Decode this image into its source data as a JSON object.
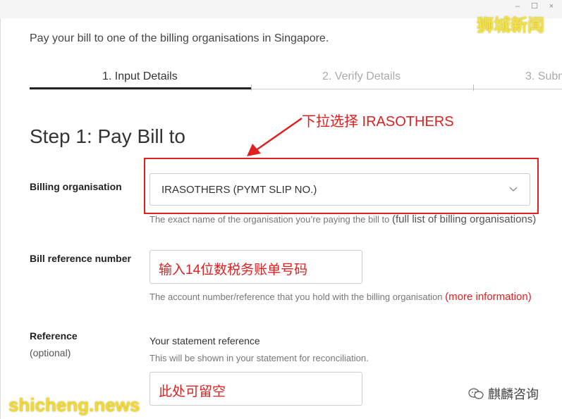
{
  "window": {
    "controls": {
      "minimize": "–",
      "maximize": "☐",
      "close": "×"
    }
  },
  "intro": "Pay your bill to one of the billing organisations in Singapore.",
  "steps": [
    {
      "label": "1. Input Details",
      "state": "active"
    },
    {
      "label": "2. Verify Details",
      "state": "inactive"
    },
    {
      "label": "3. Subm",
      "state": "inactive"
    }
  ],
  "step_heading": "Step 1: Pay Bill to",
  "billing_org": {
    "label": "Billing organisation",
    "value": "IRASOTHERS (PYMT SLIP NO.)",
    "hint": "The exact name of the organisation you’re paying the bill to",
    "hint_link": "(full list of billing organisations)"
  },
  "bill_ref": {
    "label": "Bill reference number",
    "value": "输入14位数税务账单号码",
    "hint": "The account number/reference that you hold with the billing organisation",
    "hint_link": "(more information)"
  },
  "reference": {
    "label": "Reference",
    "sublabel": "(optional)",
    "title": "Your statement reference",
    "hint": "This will be shown in your statement for reconciliation.",
    "value": "此处可留空"
  },
  "annotation": {
    "text": "下拉选择 IRASOTHERS",
    "color": "#e02020"
  },
  "watermarks": {
    "top_right": "狮城新闻",
    "bottom_left": "shicheng.news",
    "bottom_right": "麒麟咨询"
  }
}
